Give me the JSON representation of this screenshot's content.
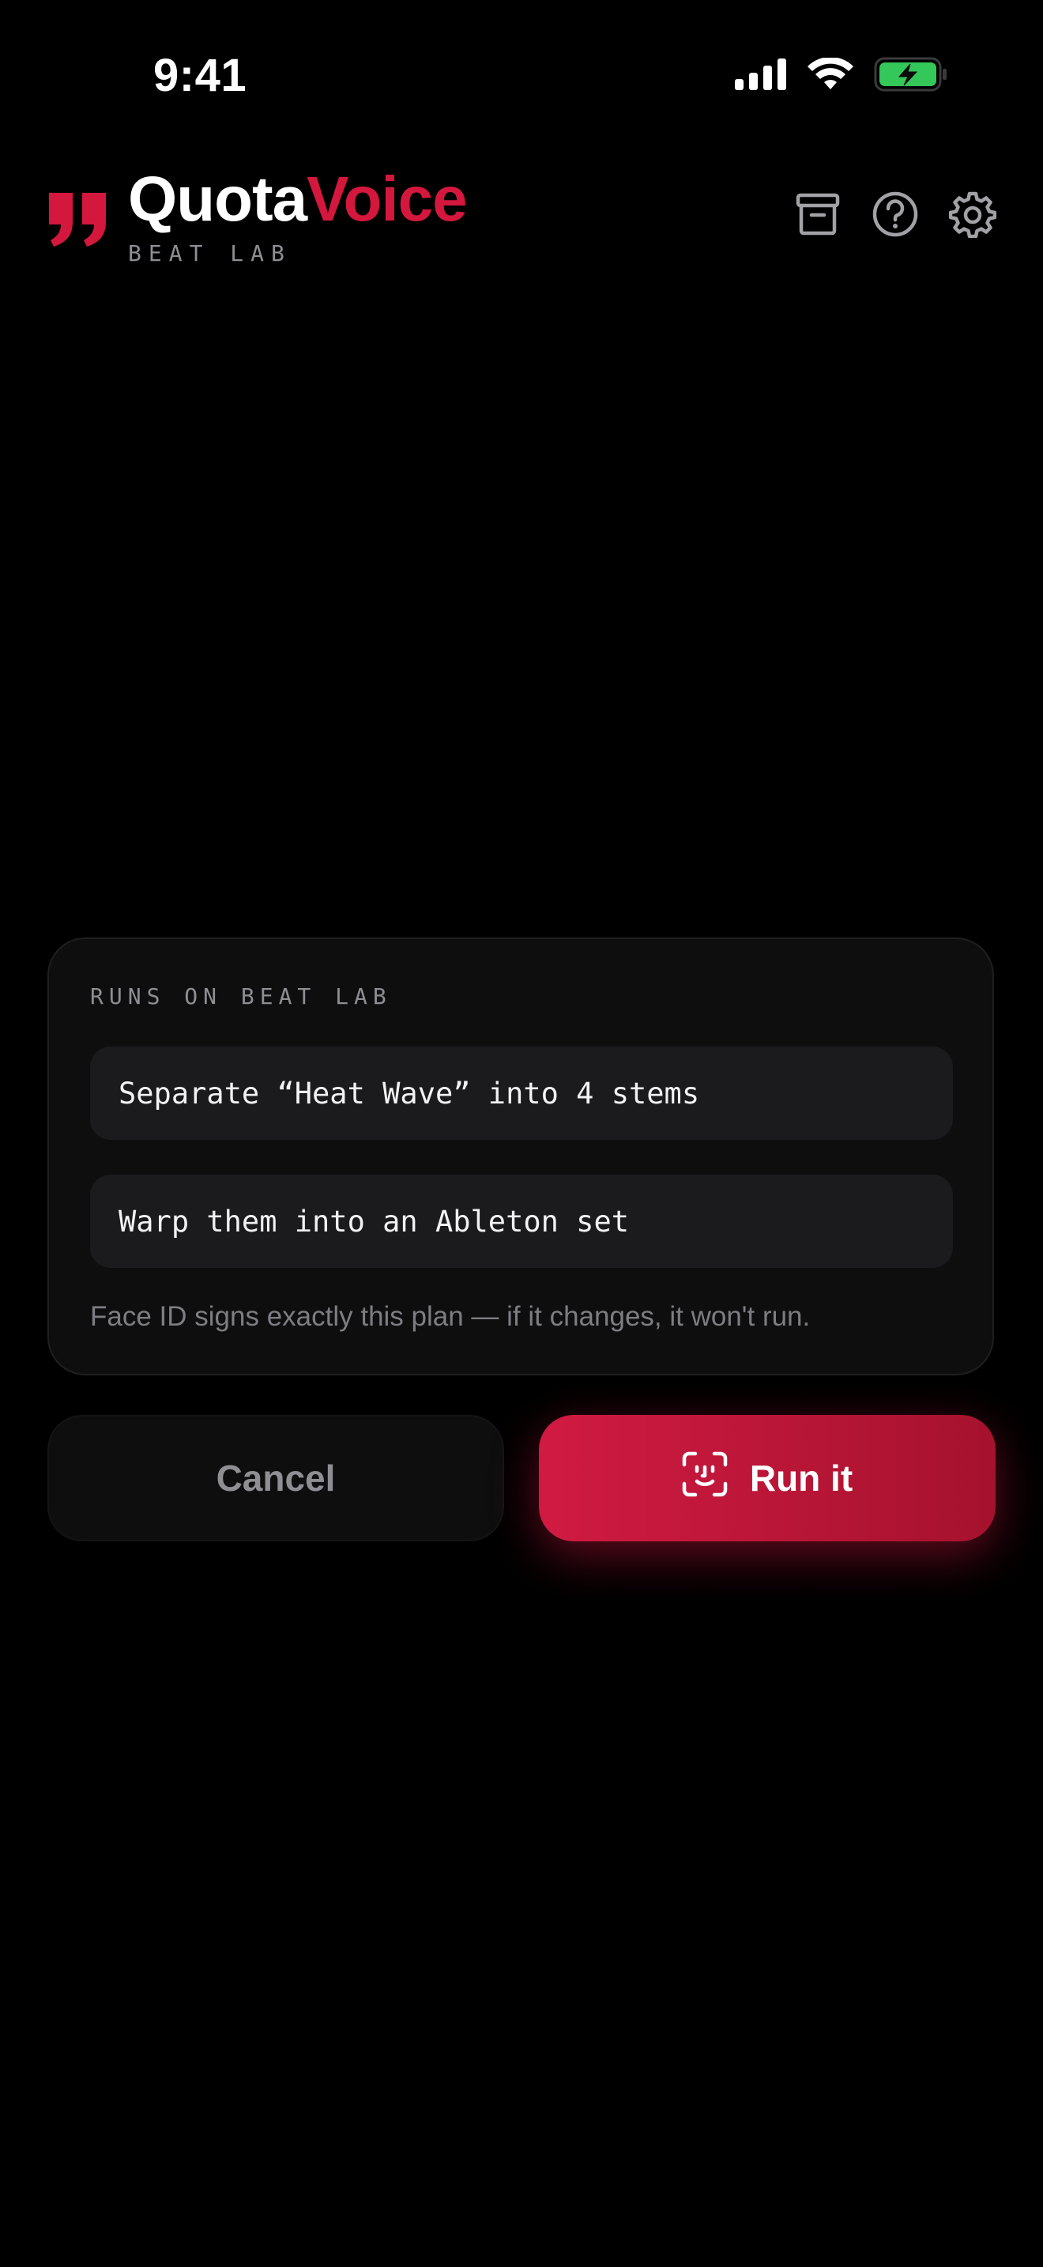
{
  "status_bar": {
    "time": "9:41",
    "icons": [
      "cellular-signal-icon",
      "wifi-icon",
      "battery-charging-icon"
    ],
    "battery_color": "#34c759"
  },
  "header": {
    "brand_part1": "Quota",
    "brand_part2": "Voice",
    "subtitle": "BEAT LAB",
    "logo_icon": "quote-mark-icon",
    "actions": [
      "archive-icon",
      "help-icon",
      "settings-gear-icon"
    ]
  },
  "plan": {
    "label": "RUNS ON BEAT LAB",
    "steps": [
      "Separate “Heat Wave” into 4 stems",
      "Warp them into an Ableton set"
    ],
    "note": "Face ID signs exactly this plan — if it changes, it won't run."
  },
  "actions": {
    "cancel_label": "Cancel",
    "run_label": "Run it",
    "run_icon": "face-id-icon"
  },
  "colors": {
    "accent": "#d4173d",
    "background": "#000000",
    "card": "#0e0e0f",
    "muted": "#8e8e93"
  }
}
